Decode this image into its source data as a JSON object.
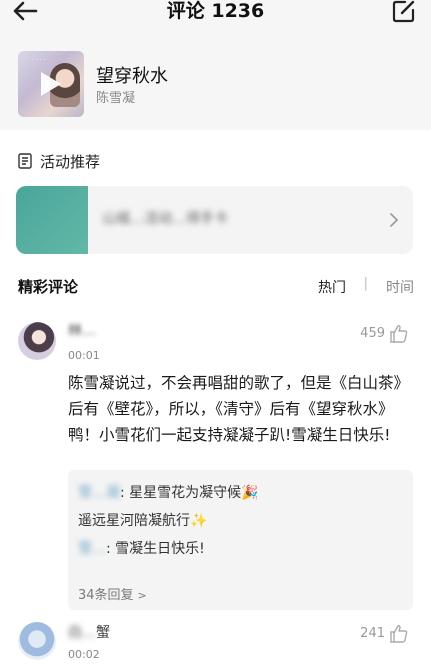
{
  "header": {
    "title": "评论 1236",
    "back_icon": "arrow-left-icon",
    "edit_icon": "edit-square-icon"
  },
  "song": {
    "title": "望穿秋水",
    "artist": "陈雪凝"
  },
  "activity": {
    "section_title": "活动推荐",
    "card_text": "山城…活动…得手卡"
  },
  "comments_section": {
    "title": "精彩评论",
    "sort_hot": "热门",
    "sort_separator": "|",
    "sort_time": "时间"
  },
  "comments": [
    {
      "username": "林…",
      "time": "00:01",
      "likes": "459",
      "text": "陈雪凝说过，不会再唱甜的歌了，但是《白山茶》后有《壁花》，所以，《清守》后有《望穿秋水》鸭！小雪花们一起支持凝凝子趴!雪凝生日快乐!",
      "replies": [
        {
          "name": "雪…凝",
          "sep": ":",
          "text": "星星雪花为凝守候",
          "emoji": "🎉"
        },
        {
          "name": "",
          "sep": "",
          "text": "遥远星河陪凝航行",
          "emoji": "✨"
        },
        {
          "name": "雪…",
          "sep": ":",
          "text": "雪凝生日快乐!",
          "emoji": ""
        }
      ],
      "reply_count": "34条回复",
      "reply_arrow": ">"
    },
    {
      "username_prefix": "白…",
      "username_suffix": "蟹",
      "time": "00:02",
      "likes": "241"
    }
  ]
}
